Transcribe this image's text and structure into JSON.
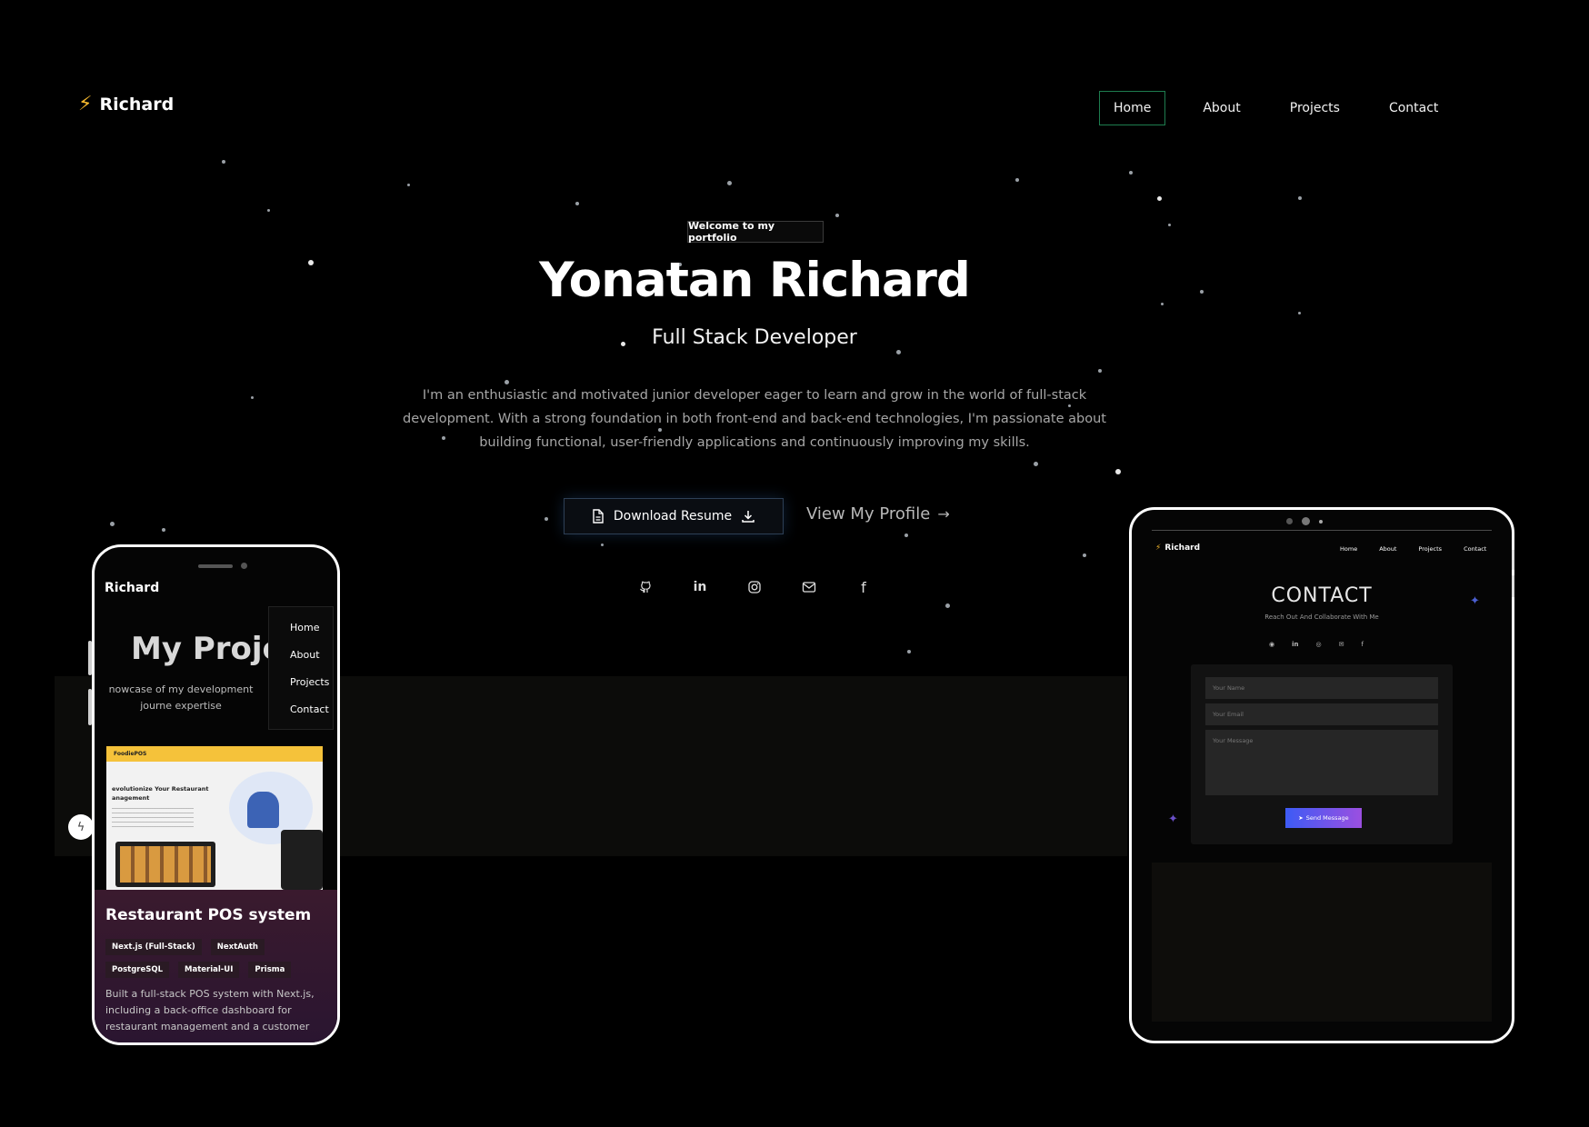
{
  "header": {
    "logo_text": "Richard",
    "nav": [
      "Home",
      "About",
      "Projects",
      "Contact"
    ],
    "active_nav": "Home"
  },
  "hero": {
    "badge": "Welcome to my portfolio",
    "name": "Yonatan Richard",
    "role": "Full Stack Developer",
    "description": "I'm an enthusiastic and motivated junior developer eager to learn and grow in the world of full-stack development. With a strong foundation in both front-end and back-end technologies, I'm passionate about building functional, user-friendly applications and continuously improving my skills.",
    "download_button": "Download Resume",
    "profile_button": "View My Profile"
  },
  "socials": [
    "github-icon",
    "linkedin-icon",
    "instagram-icon",
    "mail-icon",
    "facebook-icon"
  ],
  "phone_mockup": {
    "logo_text": "Richard",
    "menu": [
      "Home",
      "About",
      "Projects",
      "Contact"
    ],
    "section_title": "My Projec",
    "section_description": "nowcase of my development journe expertise",
    "screenshot": {
      "brand": "FoodiePOS",
      "headline": "evolutionize Your Restaurant anagement"
    },
    "project": {
      "title": "Restaurant POS system",
      "tags": [
        "Next.js (Full-Stack)",
        "NextAuth",
        "PostgreSQL",
        "Material-UI",
        "Prisma"
      ],
      "description": "Built a full-stack POS system with Next.js, including a back-office dashboard for restaurant management and a customer"
    }
  },
  "tablet_mockup": {
    "logo_text": "Richard",
    "nav": [
      "Home",
      "About",
      "Projects",
      "Contact"
    ],
    "title": "CONTACT",
    "subtitle": "Reach Out And Collaborate With Me",
    "name_placeholder": "Your Name",
    "email_placeholder": "Your Email",
    "message_placeholder": "Your Message",
    "send_button": "Send Message"
  },
  "colors": {
    "background": "#000000",
    "accent_bolt": "#f5b82e",
    "active_nav_border": "#1e7d4f",
    "send_gradient_start": "#3d5bf5",
    "send_gradient_end": "#9b4fe0"
  }
}
